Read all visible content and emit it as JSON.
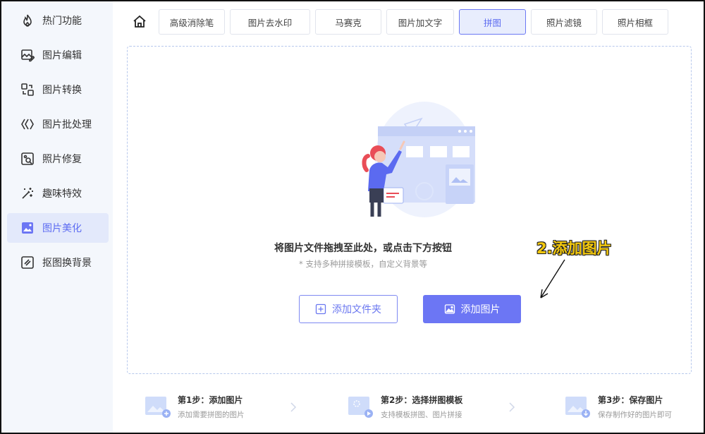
{
  "sidebar": {
    "items": [
      {
        "label": "热门功能",
        "icon": "fire-icon",
        "active": false
      },
      {
        "label": "图片编辑",
        "icon": "image-edit-icon",
        "active": false
      },
      {
        "label": "图片转换",
        "icon": "convert-icon",
        "active": false
      },
      {
        "label": "图片批处理",
        "icon": "batch-icon",
        "active": false
      },
      {
        "label": "照片修复",
        "icon": "photo-repair-icon",
        "active": false
      },
      {
        "label": "趣味特效",
        "icon": "magic-wand-icon",
        "active": false
      },
      {
        "label": "图片美化",
        "icon": "beautify-icon",
        "active": true
      },
      {
        "label": "抠图换背景",
        "icon": "cutout-icon",
        "active": false
      }
    ]
  },
  "toolbar": {
    "home_icon": "home-icon",
    "tabs": [
      {
        "label": "高级消除笔",
        "active": false
      },
      {
        "label": "图片去水印",
        "active": false
      },
      {
        "label": "马赛克",
        "active": false
      },
      {
        "label": "图片加文字",
        "active": false
      },
      {
        "label": "拼图",
        "active": true
      },
      {
        "label": "照片滤镜",
        "active": false
      },
      {
        "label": "照片相框",
        "active": false
      }
    ]
  },
  "dropzone": {
    "title": "将图片文件拖拽至此处，或点击下方按钮",
    "hint": "* 支持多种拼接模板，自定义背景等",
    "add_folder_label": "添加文件夹",
    "add_image_label": "添加图片"
  },
  "annotation": {
    "text": "2.添加图片"
  },
  "steps": [
    {
      "title": "第1步：添加图片",
      "subtitle": "添加需要拼图的图片"
    },
    {
      "title": "第2步：选择拼图模板",
      "subtitle": "支持模板拼图、图片拼接"
    },
    {
      "title": "第3步：保存图片",
      "subtitle": "保存制作好的图片即可"
    }
  ],
  "colors": {
    "accent": "#6c76f4",
    "sidebar_bg": "#f4f7fc",
    "sidebar_active_bg": "#e3e9fb",
    "annotation_text": "#f3c80e"
  }
}
